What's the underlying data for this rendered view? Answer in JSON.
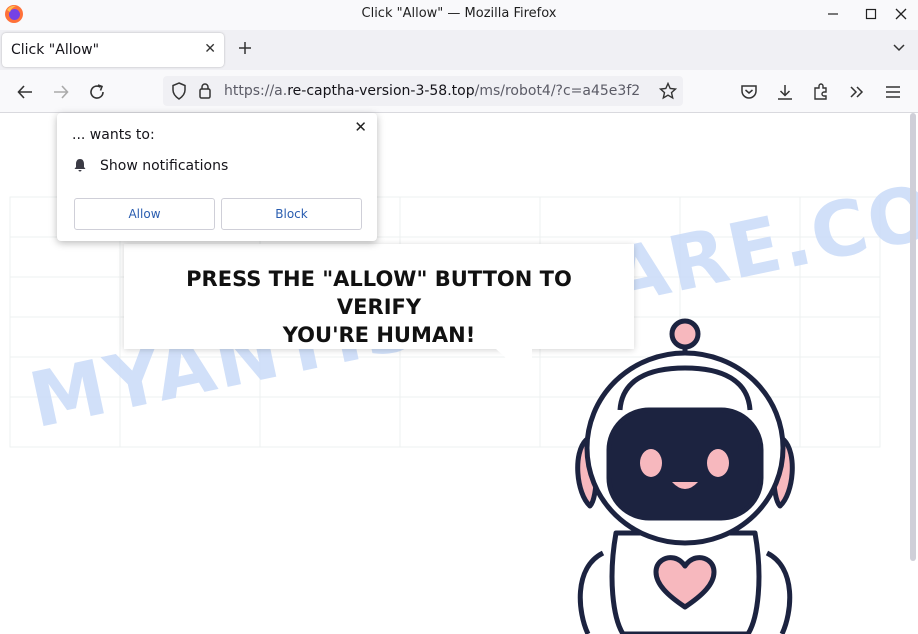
{
  "window": {
    "title": "Click \"Allow\" — Mozilla Firefox"
  },
  "tab": {
    "label": "Click \"Allow\"",
    "close": "✕"
  },
  "address": {
    "scheme": "https://a.",
    "host": "re-captha-version-3-58.top",
    "path": "/ms/robot4/?c=a45e3f2"
  },
  "popup": {
    "wants": "... wants to:",
    "permission": "Show notifications",
    "allow_label": "Allow",
    "block_label": "Block",
    "close": "✕"
  },
  "page": {
    "headline_line1": "PRESS THE \"ALLOW\" BUTTON TO VERIFY",
    "headline_line2": "YOU'RE HUMAN!",
    "watermark": "MYANTISPYWARE.COM"
  },
  "colors": {
    "robot_outline": "#1c2340",
    "robot_pink": "#f7b8be",
    "robot_face": "#1c2340",
    "watermark": "#c9dbf8",
    "link_blue": "#2a5db0"
  },
  "icons": [
    "firefox-logo",
    "minimize-icon",
    "maximize-icon",
    "close-icon",
    "back-icon",
    "forward-icon",
    "reload-icon",
    "shield-icon",
    "lock-icon",
    "star-icon",
    "pocket-icon",
    "download-icon",
    "extensions-icon",
    "overflow-icon",
    "menu-icon",
    "bell-icon"
  ]
}
